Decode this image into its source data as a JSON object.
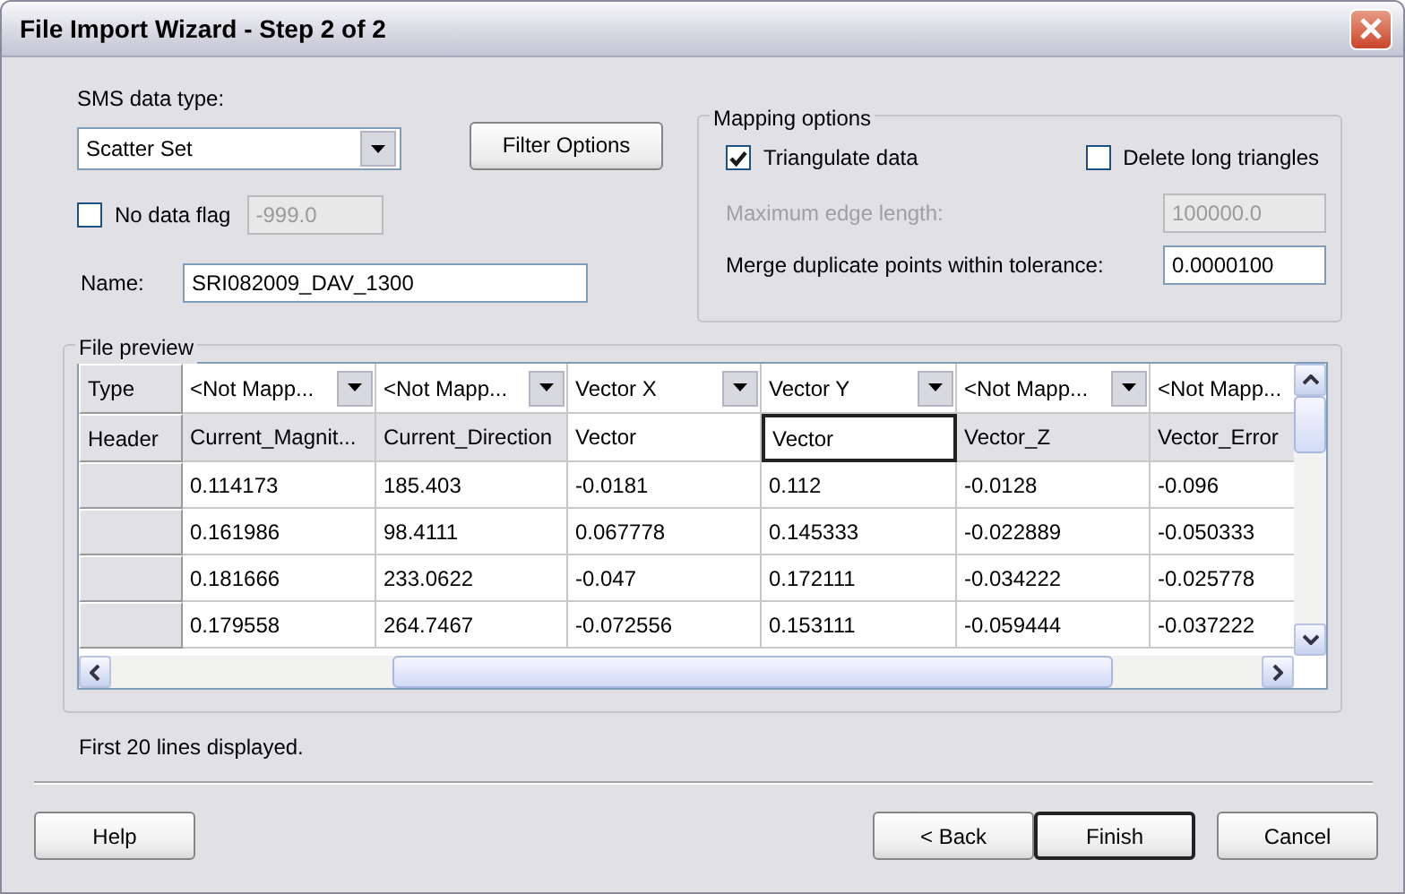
{
  "window": {
    "title": "File Import Wizard - Step 2 of 2"
  },
  "data_type": {
    "label": "SMS data type:",
    "value": "Scatter Set"
  },
  "filter_button": "Filter Options",
  "no_data_flag": {
    "label": "No data flag",
    "checked": false,
    "value": "-999.0",
    "disabled": true
  },
  "name": {
    "label": "Name:",
    "value": "SRI082009_DAV_1300"
  },
  "mapping_options": {
    "title": "Mapping options",
    "checks": [
      {
        "label": "Triangulate data",
        "checked": true
      },
      {
        "label": "Delete long triangles",
        "checked": false
      }
    ],
    "fields": [
      {
        "label": "Maximum edge length:",
        "value": "100000.0",
        "disabled": true
      },
      {
        "label": "Merge duplicate points within tolerance:",
        "value": "0.0000100",
        "disabled": false
      }
    ]
  },
  "file_preview": {
    "title": "File preview",
    "type_label": "Type",
    "header_label": "Header",
    "columns": [
      {
        "type": "<Not Mapp...",
        "header": "Current_Magnit...",
        "mapped": false,
        "editing": false,
        "partial": false
      },
      {
        "type": "<Not Mapp...",
        "header": "Current_Direction",
        "mapped": false,
        "editing": false,
        "partial": false
      },
      {
        "type": "Vector X",
        "header": "Vector",
        "mapped": true,
        "editing": false,
        "partial": false
      },
      {
        "type": "Vector Y",
        "header": "Vector",
        "mapped": true,
        "editing": true,
        "partial": false
      },
      {
        "type": "<Not Mapp...",
        "header": "Vector_Z",
        "mapped": false,
        "editing": false,
        "partial": false
      },
      {
        "type": "<Not Mapp...",
        "header": "Vector_Error",
        "mapped": false,
        "editing": false,
        "partial": true
      }
    ],
    "rows": [
      [
        "0.114173",
        "185.403",
        "-0.0181",
        "0.112",
        "-0.0128",
        "-0.096"
      ],
      [
        "0.161986",
        "98.4111",
        "0.067778",
        "0.145333",
        "-0.022889",
        "-0.050333"
      ],
      [
        "0.181666",
        "233.0622",
        "-0.047",
        "0.172111",
        "-0.034222",
        "-0.025778"
      ],
      [
        "0.179558",
        "264.7467",
        "-0.072556",
        "0.153111",
        "-0.059444",
        "-0.037222"
      ]
    ]
  },
  "status": "First 20 lines displayed.",
  "buttons": [
    {
      "label": "Help",
      "default": false
    },
    {
      "label": "< Back",
      "default": false
    },
    {
      "label": "Finish",
      "default": true
    },
    {
      "label": "Cancel",
      "default": false
    }
  ]
}
